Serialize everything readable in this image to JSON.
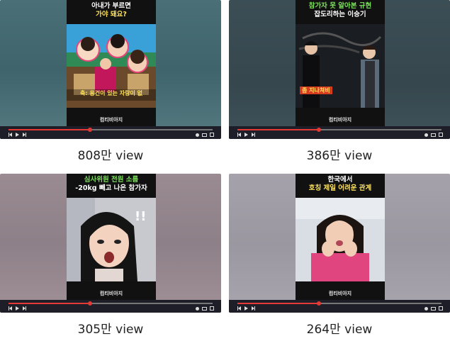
{
  "videos": [
    {
      "title_line1": "아내가 부르면",
      "title_line2": "가야 돼요?",
      "subtitle": "축: 용건이 있는 자랑이 없",
      "footer": "컴티비아지",
      "views": "808만 view",
      "progress": 0.4
    },
    {
      "title_line1": "참가자 못 알아본 규현",
      "title_line2": "잡도리하는 이승기",
      "subtitle": "좀 지나쳐비",
      "footer": "컴티비아지",
      "views": "386만 view",
      "progress": 0.4
    },
    {
      "title_line1": "심사위원 전원 소름",
      "title_line2": "-20kg 빼고 나온 참가자",
      "subtitle": "!!",
      "footer": "컴티비아지",
      "views": "305만 view",
      "progress": 0.4
    },
    {
      "title_line1": "한국에서",
      "title_line2": "호칭 제일 어려운 관계",
      "subtitle": "",
      "footer": "컴티비아지",
      "views": "264만 view",
      "progress": 0.4
    }
  ],
  "colors": {
    "progress": "#e53935",
    "accent_yellow": "#ffe35a",
    "accent_green": "#7be35a"
  }
}
